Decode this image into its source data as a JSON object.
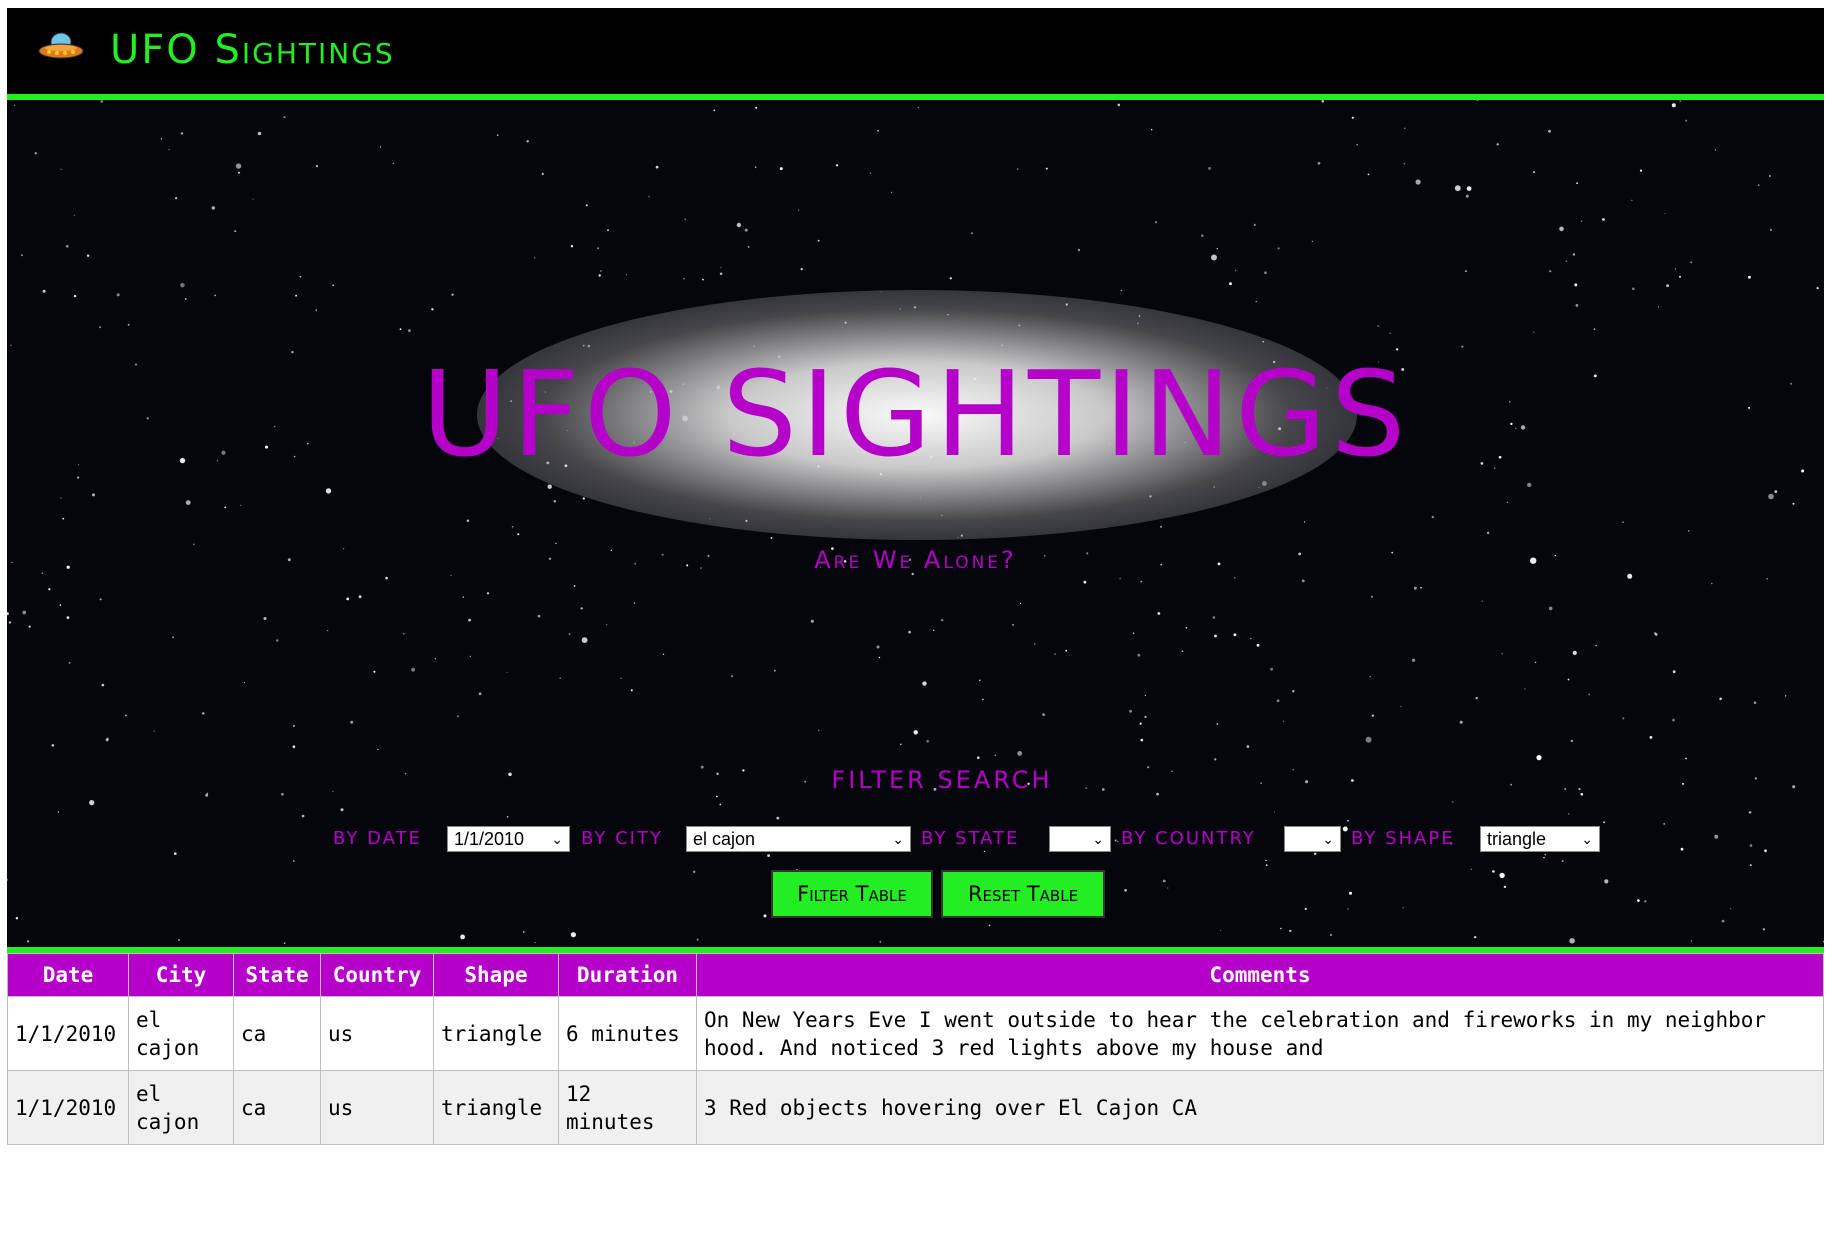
{
  "navbar": {
    "brand_icon": "ufo-icon",
    "title": "UFO Sightings"
  },
  "hero": {
    "title": "UFO SIGHTINGS",
    "subtitle": "Are We Alone?"
  },
  "filters": {
    "heading": "FILTER SEARCH",
    "date_label": "BY DATE",
    "date_value": "1/1/2010",
    "city_label": "BY CITY",
    "city_value": "el cajon",
    "state_label": "BY STATE",
    "state_value": "",
    "country_label": "BY COUNTRY",
    "country_value": "",
    "shape_label": "BY SHAPE",
    "shape_value": "triangle"
  },
  "buttons": {
    "filter": "Filter Table",
    "reset": "Reset Table"
  },
  "table": {
    "headers": [
      "Date",
      "City",
      "State",
      "Country",
      "Shape",
      "Duration",
      "Comments"
    ],
    "rows": [
      [
        "1/1/2010",
        "el cajon",
        "ca",
        "us",
        "triangle",
        "6 minutes",
        "On New Years Eve I went outside to hear the celebration and fireworks in my neighbor hood. And noticed 3 red lights above my house and"
      ],
      [
        "1/1/2010",
        "el cajon",
        "ca",
        "us",
        "triangle",
        "12 minutes",
        "3 Red objects hovering over El Cajon CA"
      ]
    ]
  },
  "colors": {
    "accent_green": "#22ee22",
    "accent_magenta": "#b400c8",
    "nav_background": "#000000"
  }
}
